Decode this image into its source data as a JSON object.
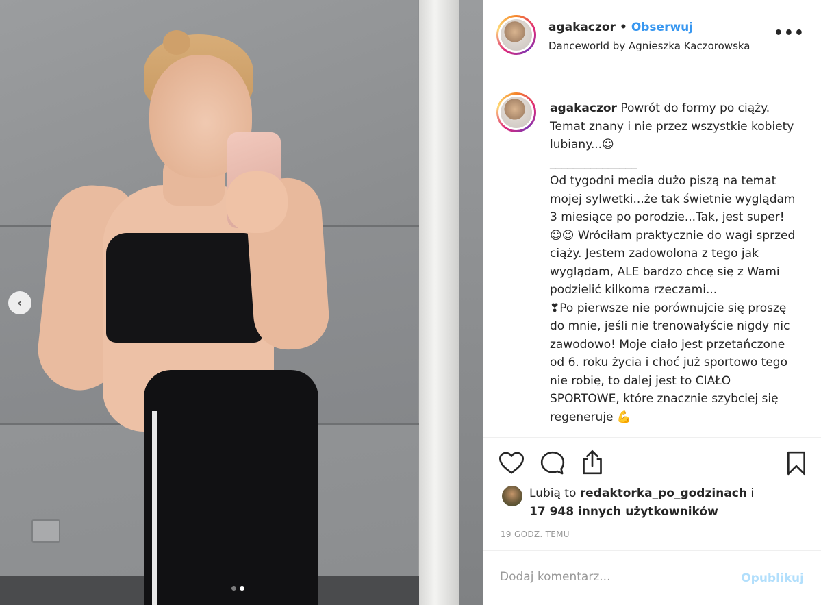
{
  "post": {
    "photo": {
      "prev_arrow_icon": "chevron-left-icon",
      "carousel_dots": 2,
      "active_dot": 2
    }
  },
  "header": {
    "username": "agakaczor",
    "separator": "•",
    "follow_label": "Obserwuj",
    "location": "Danceworld by Agnieszka Kaczorowska",
    "more_icon": "more-horizontal-icon",
    "more_label": "•••"
  },
  "caption": {
    "username": "agakaczor",
    "text": " Powrót do formy po ciąży. Temat znany i nie przez wszystkie kobiety lubiany...☺\n_______________\nOd tygodni media dużo piszą na temat mojej sylwetki...że tak świetnie wyglądam 3 miesiące po porodzie...Tak, jest super! ☺😉 Wróciłam praktycznie do wagi sprzed ciąży. Jestem zadowolona z tego jak wyglądam, ALE bardzo chcę się z Wami podzielić kilkoma rzeczami...\n❣Po pierwsze nie porównujcie się proszę do mnie, jeśli nie trenowałyście nigdy nic zawodowo! Moje ciało jest przetańczone od 6. roku życia i choć już sportowo tego nie robię, to dalej jest to CIAŁO SPORTOWE, które znacznie szybciej się regeneruje 💪"
  },
  "actions": {
    "like_icon": "heart-icon",
    "comment_icon": "comment-icon",
    "share_icon": "share-icon",
    "save_icon": "bookmark-icon"
  },
  "likes": {
    "prefix": "Lubią to ",
    "first_user": "redaktorka_po_godzinach",
    "middle": " i",
    "others": "17 948 innych użytkowników"
  },
  "timestamp": "19 GODZ. TEMU",
  "comment_box": {
    "placeholder": "Dodaj komentarz...",
    "value": "",
    "publish_label": "Opublikuj"
  },
  "colors": {
    "accent": "#3897f0",
    "publish_disabled": "#b2dffc",
    "text": "#262626",
    "muted": "#999999"
  }
}
